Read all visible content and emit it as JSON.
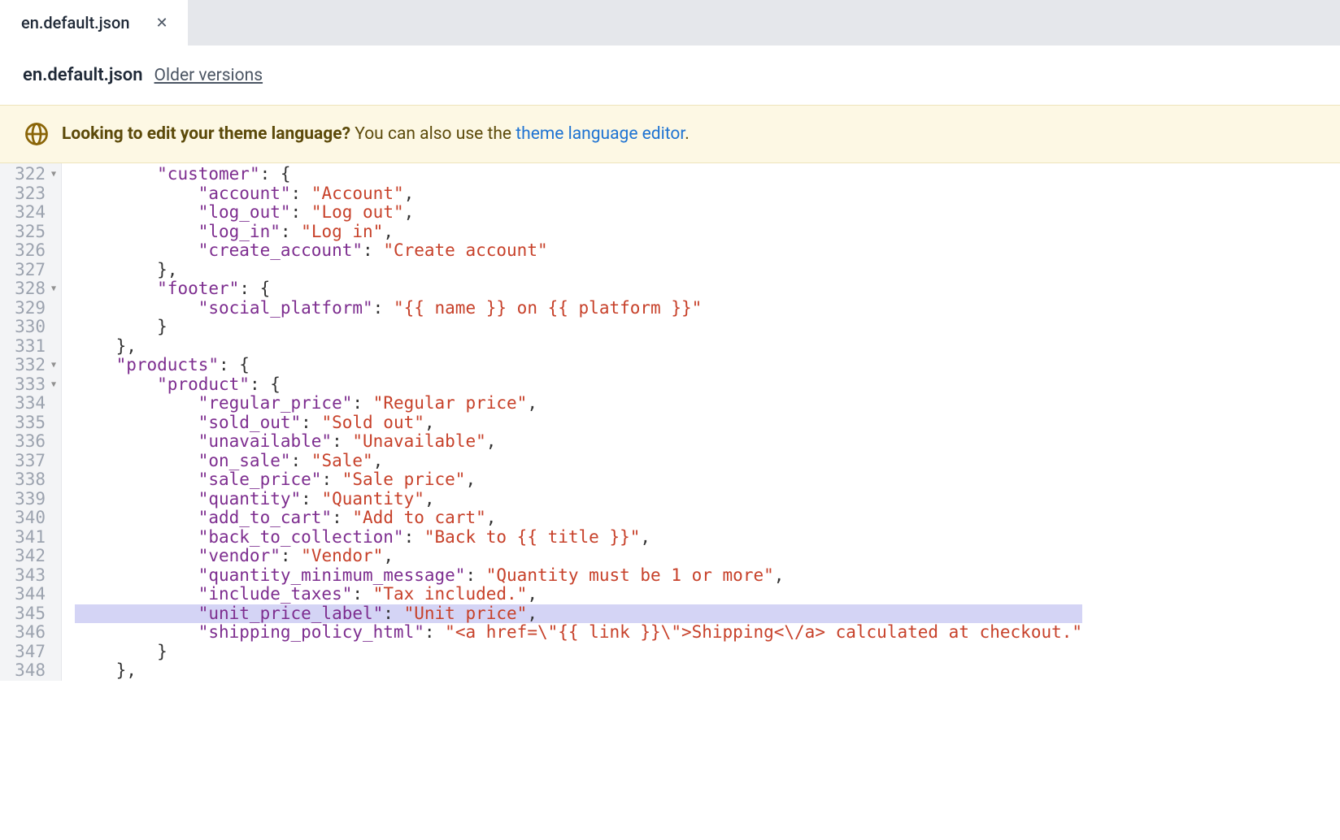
{
  "tab": {
    "label": "en.default.json"
  },
  "header": {
    "title": "en.default.json",
    "older_versions": "Older versions"
  },
  "banner": {
    "strong": "Looking to edit your theme language?",
    "text": " You can also use the ",
    "link": "theme language editor",
    "period": "."
  },
  "gutter": {
    "start": 322,
    "end": 348,
    "foldable": [
      322,
      328,
      332,
      333
    ]
  },
  "code_lines": [
    {
      "n": 322,
      "indent": 4,
      "key": "customer",
      "after": ": {",
      "fold": true
    },
    {
      "n": 323,
      "indent": 6,
      "key": "account",
      "val": "Account",
      "trail": ","
    },
    {
      "n": 324,
      "indent": 6,
      "key": "log_out",
      "val": "Log out",
      "trail": ","
    },
    {
      "n": 325,
      "indent": 6,
      "key": "log_in",
      "val": "Log in",
      "trail": ","
    },
    {
      "n": 326,
      "indent": 6,
      "key": "create_account",
      "val": "Create account"
    },
    {
      "n": 327,
      "indent": 4,
      "raw": "},"
    },
    {
      "n": 328,
      "indent": 4,
      "key": "footer",
      "after": ": {",
      "fold": true
    },
    {
      "n": 329,
      "indent": 6,
      "key": "social_platform",
      "val": "{{ name }} on {{ platform }}"
    },
    {
      "n": 330,
      "indent": 4,
      "raw": "}"
    },
    {
      "n": 331,
      "indent": 2,
      "raw": "},"
    },
    {
      "n": 332,
      "indent": 2,
      "key": "products",
      "after": ": {",
      "fold": true
    },
    {
      "n": 333,
      "indent": 4,
      "key": "product",
      "after": ": {",
      "fold": true
    },
    {
      "n": 334,
      "indent": 6,
      "key": "regular_price",
      "val": "Regular price",
      "trail": ","
    },
    {
      "n": 335,
      "indent": 6,
      "key": "sold_out",
      "val": "Sold out",
      "trail": ","
    },
    {
      "n": 336,
      "indent": 6,
      "key": "unavailable",
      "val": "Unavailable",
      "trail": ","
    },
    {
      "n": 337,
      "indent": 6,
      "key": "on_sale",
      "val": "Sale",
      "trail": ","
    },
    {
      "n": 338,
      "indent": 6,
      "key": "sale_price",
      "val": "Sale price",
      "trail": ","
    },
    {
      "n": 339,
      "indent": 6,
      "key": "quantity",
      "val": "Quantity",
      "trail": ","
    },
    {
      "n": 340,
      "indent": 6,
      "key": "add_to_cart",
      "val": "Add to cart",
      "trail": ","
    },
    {
      "n": 341,
      "indent": 6,
      "key": "back_to_collection",
      "val": "Back to {{ title }}",
      "trail": ","
    },
    {
      "n": 342,
      "indent": 6,
      "key": "vendor",
      "val": "Vendor",
      "trail": ","
    },
    {
      "n": 343,
      "indent": 6,
      "key": "quantity_minimum_message",
      "val": "Quantity must be 1 or more",
      "trail": ","
    },
    {
      "n": 344,
      "indent": 6,
      "key": "include_taxes",
      "val": "Tax included.",
      "trail": ","
    },
    {
      "n": 345,
      "indent": 6,
      "key": "unit_price_label",
      "val": "Unit price",
      "trail": ",",
      "hl": true
    },
    {
      "n": 346,
      "indent": 6,
      "key": "shipping_policy_html",
      "val": "<a href=\\\"{{ link }}\\\">Shipping<\\/a> calculated at checkout."
    },
    {
      "n": 347,
      "indent": 4,
      "raw": "}"
    },
    {
      "n": 348,
      "indent": 2,
      "raw": "},"
    }
  ],
  "highlighted_line": 345
}
